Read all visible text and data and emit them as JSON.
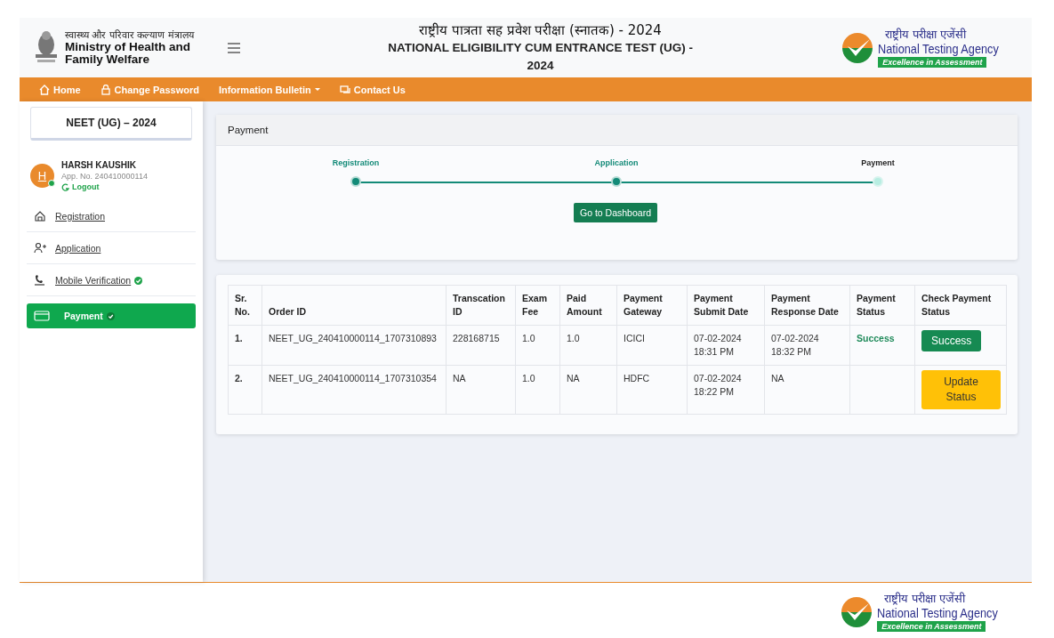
{
  "header": {
    "ministry_hindi": "स्वास्थ्य और परिवार कल्याण मंत्रालय",
    "ministry_english": "Ministry of Health and Family Welfare",
    "title_hindi": "राष्ट्रीय पात्रता सह प्रवेश परीक्षा (स्नातक) - 2024",
    "title_english": "NATIONAL ELIGIBILITY CUM ENTRANCE TEST (UG) - 2024",
    "agency_hindi": "राष्ट्रीय परीक्षा एजेंसी",
    "agency_english": "National Testing Agency",
    "agency_tagline": "Excellence in Assessment"
  },
  "nav": [
    {
      "label": "Home",
      "kind": "link"
    },
    {
      "label": "Change Password",
      "kind": "link"
    },
    {
      "label": "Information Bulletin",
      "kind": "dropdown"
    },
    {
      "label": "Contact Us",
      "kind": "link"
    }
  ],
  "sidebar": {
    "exam_title": "NEET (UG) – 2024",
    "user": {
      "initial": "H",
      "name": "HARSH KAUSHIK",
      "app_no": "App. No. 240410000114",
      "online": true,
      "logout": "Logout"
    },
    "items": [
      {
        "label": "Registration",
        "selected": false,
        "verified": false
      },
      {
        "label": "Application",
        "selected": false,
        "verified": false
      },
      {
        "label": "Mobile Verification",
        "selected": false,
        "verified": true
      },
      {
        "label": "Payment",
        "selected": true,
        "verified": true
      }
    ]
  },
  "payment_card": {
    "title": "Payment",
    "steps": [
      {
        "label": "Registration",
        "completed": true
      },
      {
        "label": "Application",
        "completed": true
      },
      {
        "label": "Payment",
        "completed": false
      }
    ],
    "button": "Go to Dashboard"
  },
  "table": {
    "columns": [
      "Sr. No.",
      "Order ID",
      "Transcation ID",
      "Exam Fee",
      "Paid Amount",
      "Payment Gateway",
      "Payment Submit Date",
      "Payment Response Date",
      "Payment Status",
      "Check Payment Status"
    ],
    "rows": [
      {
        "sr": "1.",
        "order_id": "NEET_UG_240410000114_1707310893",
        "transaction_id": "228168715",
        "exam_fee": "1.0",
        "paid_amount": "1.0",
        "gateway": "ICICI",
        "submit_date": "07-02-2024 18:31 PM",
        "response_date": "07-02-2024 18:32 PM",
        "status": "Success",
        "action": {
          "label": "Success",
          "kind": "success"
        }
      },
      {
        "sr": "2.",
        "order_id": "NEET_UG_240410000114_1707310354",
        "transaction_id": "NA",
        "exam_fee": "1.0",
        "paid_amount": "NA",
        "gateway": "HDFC",
        "submit_date": "07-02-2024 18:22 PM",
        "response_date": "NA",
        "action": {
          "label": "Update Status",
          "kind": "warning"
        }
      }
    ]
  },
  "footer": {
    "agency_hindi": "राष्ट्रीय परीक्षा एजेंसी",
    "agency_english": "National Testing Agency",
    "agency_tagline": "Excellence in Assessment"
  }
}
